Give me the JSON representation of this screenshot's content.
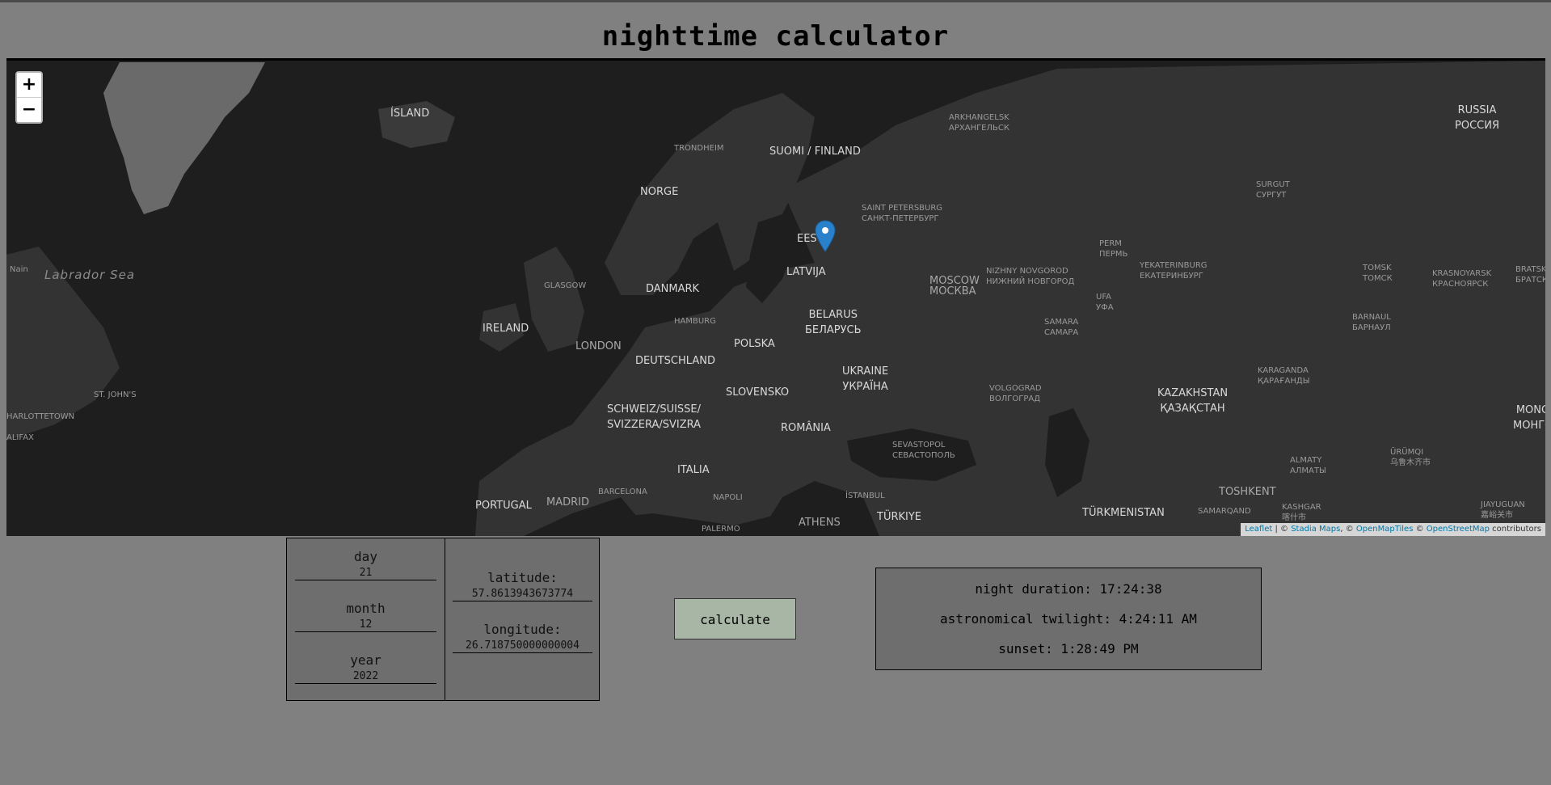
{
  "title": "nighttime calculator",
  "map": {
    "zoom_in": "+",
    "zoom_out": "−",
    "sea_label": "Labrador Sea",
    "countries": [
      {
        "label": "ÍSLAND"
      },
      {
        "label": "SUOMI / FINLAND"
      },
      {
        "label": "NORGE"
      },
      {
        "label": "EESTI"
      },
      {
        "label": "LATVIJA"
      },
      {
        "label": "DANMARK"
      },
      {
        "label": "IRELAND"
      },
      {
        "label": "BELARUS\nБЕЛАРУСЬ"
      },
      {
        "label": "POLSKA"
      },
      {
        "label": "DEUTSCHLAND"
      },
      {
        "label": "UKRAINE\nУКРАЇНА"
      },
      {
        "label": "SLOVENSKO"
      },
      {
        "label": "SCHWEIZ/SUISSE/\nSVIZZERA/SVIZRA"
      },
      {
        "label": "ROMÂNIA"
      },
      {
        "label": "ITALIA"
      },
      {
        "label": "PORTUGAL"
      },
      {
        "label": "TÜRKIYE"
      },
      {
        "label": "TÜRKMENISTAN"
      },
      {
        "label": "KAZAKHSTAN\nҚАЗАҚСТАН"
      },
      {
        "label": "RUSSIA\nРОССИЯ"
      },
      {
        "label": "MONGO\nМОНГОЛ"
      }
    ],
    "cities": [
      {
        "label": "ARKHANGELSK\nАРХАНГЕЛЬСК"
      },
      {
        "label": "TRONDHEIM"
      },
      {
        "label": "SAINT PETERSBURG\nСАНКТ-ПЕТЕРБУРГ"
      },
      {
        "label": "SURGUT\nСУРГУТ"
      },
      {
        "label": "PERM\nПЕРМЬ"
      },
      {
        "label": "YEKATERINBURG\nЕКАТЕРИНБУРГ"
      },
      {
        "label": "TOMSK\nТОМСК"
      },
      {
        "label": "KRASNOYARSK\nКРАСНОЯРСК"
      },
      {
        "label": "BRATSK\nБРАТСК"
      },
      {
        "label": "Nain"
      },
      {
        "label": "GLASGOW"
      },
      {
        "label": "MOSCOW\nМОСКВА"
      },
      {
        "label": "NIZHNY NOVGOROD\nНИЖНИЙ НОВГОРОД"
      },
      {
        "label": "UFA\nУФА"
      },
      {
        "label": "HAMBURG"
      },
      {
        "label": "SAMARA\nСАМАРА"
      },
      {
        "label": "BARNAUL\nБАРНАУЛ"
      },
      {
        "label": "LONDON"
      },
      {
        "label": "KARAGANDA\nҚАРАҒАНДЫ"
      },
      {
        "label": "ST. JOHN'S"
      },
      {
        "label": "VOLGOGRAD\nВОЛГОГРАД"
      },
      {
        "label": "HARLOTTETOWN"
      },
      {
        "label": "SEVASTOPOL\nСЕВАСТОПОЛЬ"
      },
      {
        "label": "ÜRÜMQI\n乌鲁木齐市"
      },
      {
        "label": "ALIFAX"
      },
      {
        "label": "ALMATY\nАЛМАТЫ"
      },
      {
        "label": "BARCELONA"
      },
      {
        "label": "MADRID"
      },
      {
        "label": "TOSHKENT"
      },
      {
        "label": "NAPOLI"
      },
      {
        "label": "İSTANBUL"
      },
      {
        "label": "KASHGAR\n喀什市"
      },
      {
        "label": "SAMARQAND"
      },
      {
        "label": "JIAYUGUAN\n嘉峪关市"
      },
      {
        "label": "PALERMO"
      },
      {
        "label": "ATHENS"
      }
    ],
    "attribution": {
      "leaflet": "Leaflet",
      "sep1": " | © ",
      "stadia": "Stadia Maps",
      "sep2": ", © ",
      "omt": "OpenMapTiles",
      "sep3": " © ",
      "osm": "OpenStreetMap",
      "tail": " contributors"
    }
  },
  "form": {
    "day_label": "day",
    "day_value": "21",
    "month_label": "month",
    "month_value": "12",
    "year_label": "year",
    "year_value": "2022",
    "lat_label": "latitude:",
    "lat_value": "57.8613943673774",
    "lon_label": "longitude:",
    "lon_value": "26.718750000000004"
  },
  "calculate_label": "calculate",
  "results": {
    "night_duration": "night duration: 17:24:38",
    "astronomical_twilight": "astronomical twilight: 4:24:11 AM",
    "sunset": "sunset: 1:28:49 PM"
  },
  "colors": {
    "background": "#808080",
    "map_water": "#1e1e1e",
    "map_land": "#333333",
    "marker": "#2a81cb",
    "button": "#a8b7a5"
  }
}
